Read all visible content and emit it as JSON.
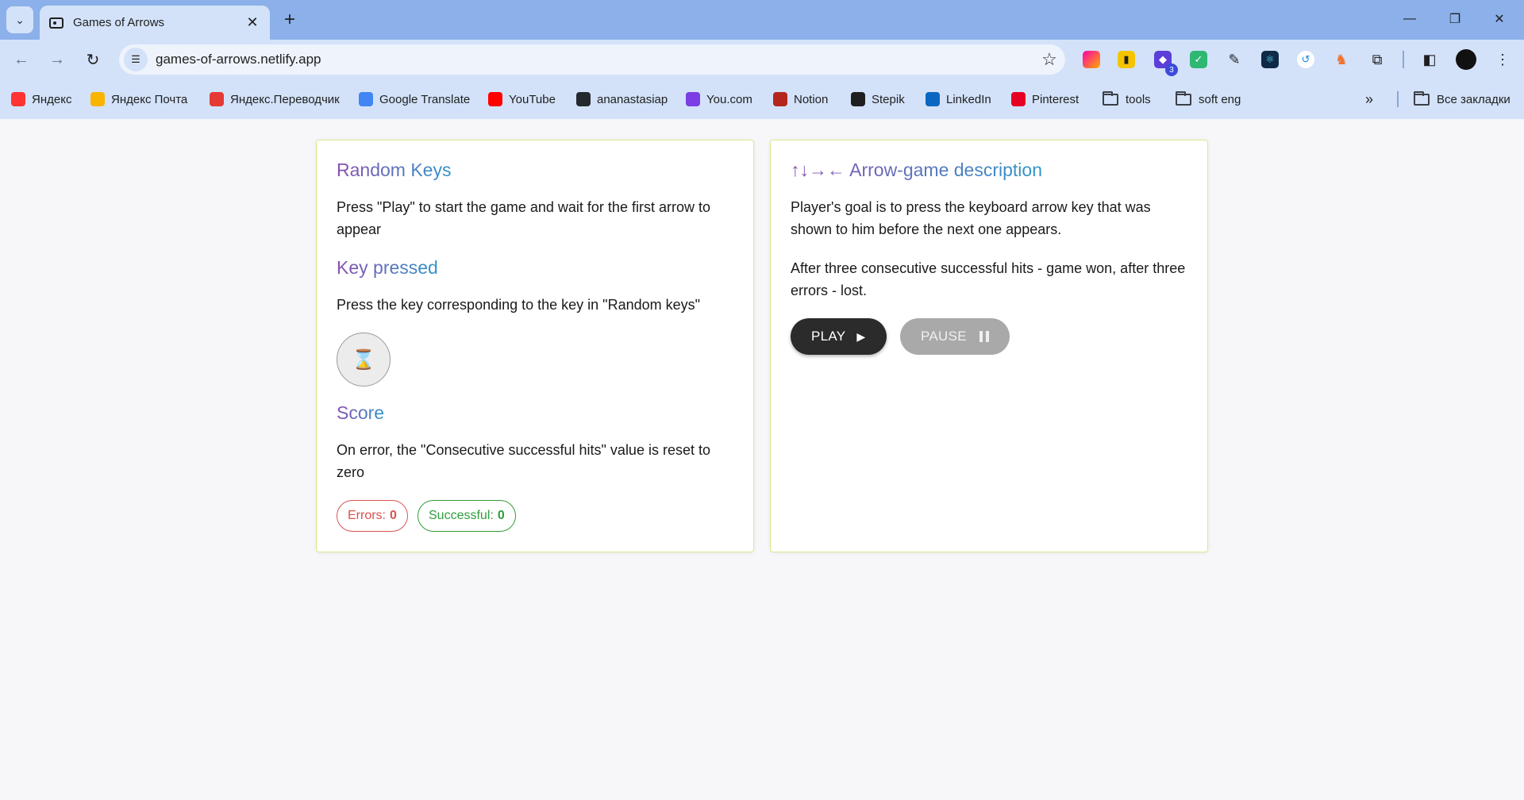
{
  "browser": {
    "tab": {
      "title": "Games of Arrows"
    },
    "url": "games-of-arrows.netlify.app",
    "extensions_badge": "3",
    "bookmarks": [
      {
        "label": "Яндекс",
        "icon": "yandex-icon",
        "color": "#f33"
      },
      {
        "label": "Яндекс Почта",
        "icon": "yandex-mail-icon",
        "color": "#f8b400"
      },
      {
        "label": "Яндекс.Переводчик",
        "icon": "translator-icon",
        "color": "#e53935"
      },
      {
        "label": "Google Translate",
        "icon": "google-translate-icon",
        "color": "#4285f4"
      },
      {
        "label": "YouTube",
        "icon": "youtube-icon",
        "color": "#ff0000"
      },
      {
        "label": "ananastasiap",
        "icon": "github-icon",
        "color": "#24292e"
      },
      {
        "label": "You.com",
        "icon": "youcom-icon",
        "color": "#7b3fe4"
      },
      {
        "label": "Notion",
        "icon": "notion-icon",
        "color": "#b3261e"
      },
      {
        "label": "Stepik",
        "icon": "stepik-icon",
        "color": "#1f1f1f"
      },
      {
        "label": "LinkedIn",
        "icon": "linkedin-icon",
        "color": "#0a66c2"
      },
      {
        "label": "Pinterest",
        "icon": "pinterest-icon",
        "color": "#e60023"
      },
      {
        "label": "tools",
        "icon": "folder-icon"
      },
      {
        "label": "soft eng",
        "icon": "folder-icon"
      }
    ],
    "all_bookmarks": "Все закладки"
  },
  "left_card": {
    "random_keys_title": "Random Keys",
    "random_keys_text": "Press \"Play\" to start the game and wait for the first arrow to appear",
    "key_pressed_title": "Key pressed",
    "key_pressed_text": "Press the key corresponding to the key in \"Random keys\"",
    "key_pressed_icon": "⌛",
    "score_title": "Score",
    "score_text": "On error, the \"Consecutive successful hits\" value is reset to zero",
    "errors_label": "Errors:",
    "errors_value": "0",
    "successful_label": "Successful:",
    "successful_value": "0"
  },
  "right_card": {
    "title": "↑↓→← Arrow-game description",
    "text_1": "Player's goal is to press the keyboard arrow key that was shown to him before the next one appears.",
    "text_2": "After three consecutive successful hits - game won, after three errors - lost.",
    "play_label": "PLAY",
    "pause_label": "PAUSE"
  },
  "colors": {
    "card_border": "#d9ea8a",
    "heading_gradient": [
      "#8a4fb0",
      "#2f96c9"
    ],
    "error": "#d9534f",
    "success": "#2e9e3a"
  }
}
